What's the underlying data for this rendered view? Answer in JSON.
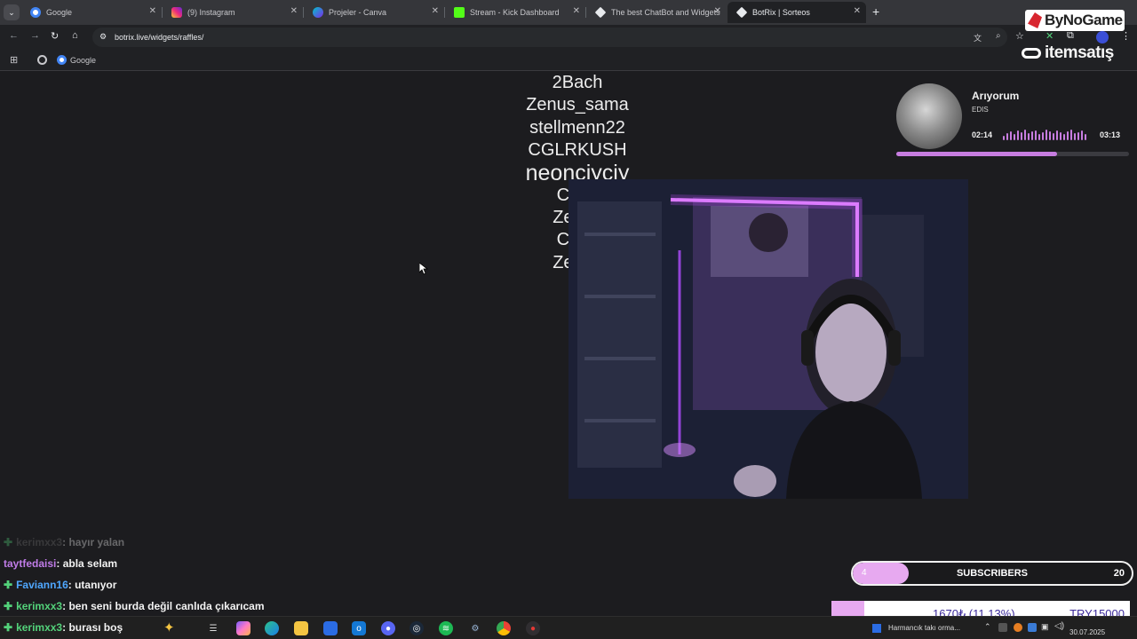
{
  "browser": {
    "tabs": [
      {
        "title": "Google",
        "icon": "google-icon",
        "color": "#4285f4"
      },
      {
        "title": "(9) Instagram",
        "icon": "instagram-icon",
        "color": "#e1306c"
      },
      {
        "title": "Projeler - Canva",
        "icon": "canva-icon",
        "color": "#00c4cc"
      },
      {
        "title": "Stream - Kick Dashboard",
        "icon": "kick-icon",
        "color": "#53fc18"
      },
      {
        "title": "The best ChatBot and Widgets",
        "icon": "botrix-icon",
        "color": "#e8eaed"
      },
      {
        "title": "BotRix | Sorteos",
        "icon": "botrix-icon",
        "color": "#e8eaed"
      }
    ],
    "active_tab_index": 5,
    "url": "botrix.live/widgets/raffles/",
    "bookmarks": [
      {
        "label": "Google",
        "icon": "google-icon"
      }
    ]
  },
  "overlay": {
    "sponsor_top": "ByNoGame",
    "sponsor_bottom": "itemsatış",
    "raffle_names": [
      "2Bach",
      "Zenus_sama",
      "stellmenn22",
      "CGLRKUSH",
      "neonciyciy",
      "CGLI",
      "Zenus",
      "CGLI",
      "Zenus"
    ],
    "music": {
      "title": "Arıyorum",
      "artist": "EDIS",
      "elapsed": "02:14",
      "duration": "03:13",
      "progress": 0.69,
      "accent": "#c77de0"
    },
    "chat": [
      {
        "user": "kerimxx3",
        "message": ": hayır yalan",
        "user_color": "#6e6e6e",
        "badge": true,
        "faded": true
      },
      {
        "user": "taytfedaisi",
        "message": ": abla selam",
        "user_color": "#c07ce8",
        "badge": false,
        "faded": false
      },
      {
        "user": "Faviann16",
        "message": ": utanıyor",
        "user_color": "#4fa7ff",
        "badge": true,
        "faded": false
      },
      {
        "user": "kerimxx3",
        "message": ": ben seni burda değil canlıda çıkarıcam",
        "user_color": "#53d27a",
        "badge": true,
        "faded": false
      },
      {
        "user": "kerimxx3",
        "message": ": burası boş",
        "user_color": "#53d27a",
        "badge": true,
        "faded": false
      }
    ],
    "sub_goal": {
      "current": "4",
      "label": "SUBSCRIBERS",
      "target": "20",
      "accent": "#e7a9f0",
      "progress": 0.2
    },
    "donation_goal": {
      "amount": "1670₺ (11.13%)",
      "target": "TRY15000",
      "accent": "#e7a9f0",
      "progress": 0.1113
    }
  },
  "taskbar": {
    "notification": "Harmancık takı orma...",
    "date": "30.07.2025"
  }
}
